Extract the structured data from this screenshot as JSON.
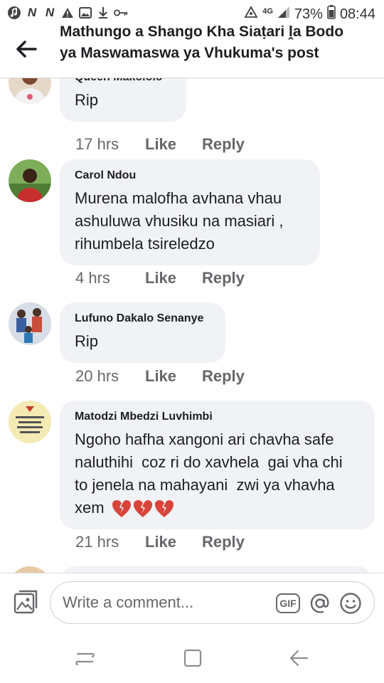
{
  "status_bar": {
    "battery": "73%",
    "time": "08:44",
    "network": "4G"
  },
  "header": {
    "title": "Mathungo a Shango Kha Siaṭari ḽa Bodo ya Maswamaswa ya Vhukuma's post"
  },
  "comments": [
    {
      "name": "Queen Makololo",
      "text": "Rip",
      "time": "17 hrs",
      "like": "Like",
      "reply": "Reply"
    },
    {
      "name": "Carol Ndou",
      "text": "Murena malofha avhana vhau ashuluwa vhusiku na masiari , rihumbela tsireledzo",
      "time": "4 hrs",
      "like": "Like",
      "reply": "Reply"
    },
    {
      "name": "Lufuno Dakalo Senanye",
      "text": "Rip",
      "time": "20 hrs",
      "like": "Like",
      "reply": "Reply"
    },
    {
      "name": "Matodzi Mbedzi Luvhimbi",
      "text": "Ngoho hafha xangoni ari chavha safe naluthihi  coz ri do xavhela  gai vha chi to jenela na mahayani  zwi ya vhavha xem",
      "emoji": "💔💔💔",
      "time": "21 hrs",
      "like": "Like",
      "reply": "Reply"
    }
  ],
  "composer": {
    "placeholder": "Write a comment...",
    "gif_label": "GIF"
  },
  "colors": {
    "bubble": "#f0f2f5",
    "meta_text": "#65676b",
    "heart": "#d9443a"
  }
}
